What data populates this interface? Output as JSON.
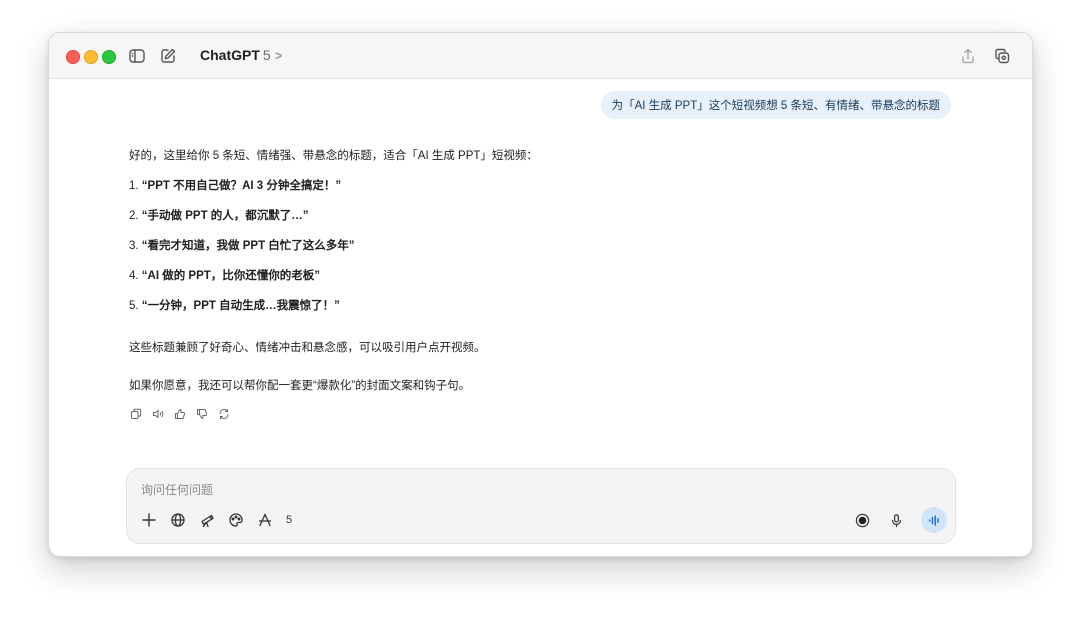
{
  "window": {
    "app_name": "ChatGPT",
    "model": "5",
    "chevron": ">"
  },
  "conversation": {
    "user_message": "为「AI 生成 PPT」这个短视频想 5 条短、有情绪、带悬念的标题",
    "reply": {
      "intro": "好的，这里给你 5 条短、情绪强、带悬念的标题，适合「AI 生成 PPT」短视频：",
      "items": [
        {
          "num": "1. ",
          "text": "“PPT 不用自己做？AI 3 分钟全搞定！”"
        },
        {
          "num": "2. ",
          "text": "“手动做 PPT 的人，都沉默了…”"
        },
        {
          "num": "3. ",
          "text": "“看完才知道，我做 PPT 白忙了这么多年”"
        },
        {
          "num": "4. ",
          "text": "“AI 做的 PPT，比你还懂你的老板”"
        },
        {
          "num": "5. ",
          "text": "“一分钟，PPT 自动生成…我震惊了！”"
        }
      ],
      "summary": "这些标题兼顾了好奇心、情绪冲击和悬念感，可以吸引用户点开视频。",
      "followup": "如果你愿意，我还可以帮你配一套更“爆款化”的封面文案和钩子句。"
    }
  },
  "composer": {
    "placeholder": "询问任何问题",
    "tool_count": "5"
  },
  "colors": {
    "bubble_bg": "#e7f0fb",
    "voice_button_bg": "#cfe4fb",
    "close": "#ff5f57",
    "minimize": "#febc2e",
    "maximize": "#28c840"
  }
}
